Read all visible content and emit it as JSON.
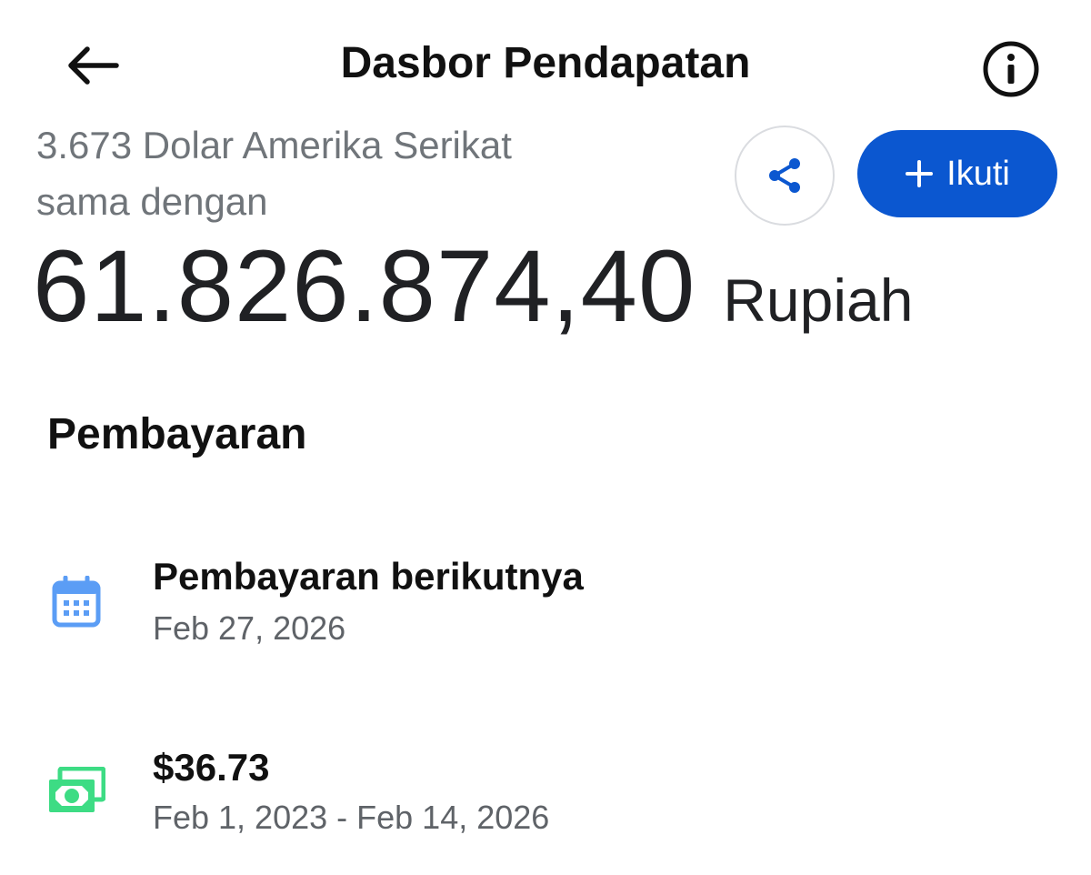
{
  "header": {
    "title": "Dasbor Pendapatan",
    "back_icon": "arrow-left-icon",
    "info_icon": "info-icon"
  },
  "conversion": {
    "line1": "3.673 Dolar Amerika Serikat",
    "line2": "sama dengan",
    "amount": "61.826.874,40",
    "unit": "Rupiah"
  },
  "actions": {
    "share_icon": "share-icon",
    "follow_label": "Ikuti",
    "follow_icon": "plus-icon",
    "accent": "#0b57d0"
  },
  "payments": {
    "section_title": "Pembayaran",
    "items": [
      {
        "icon": "calendar-icon",
        "icon_color": "#5b9df5",
        "title": "Pembayaran berikutnya",
        "subtitle": "Feb 27, 2026"
      },
      {
        "icon": "cash-icon",
        "icon_color": "#3ddc84",
        "title": "$36.73",
        "subtitle": "Feb 1, 2023 - Feb 14, 2026"
      }
    ]
  }
}
